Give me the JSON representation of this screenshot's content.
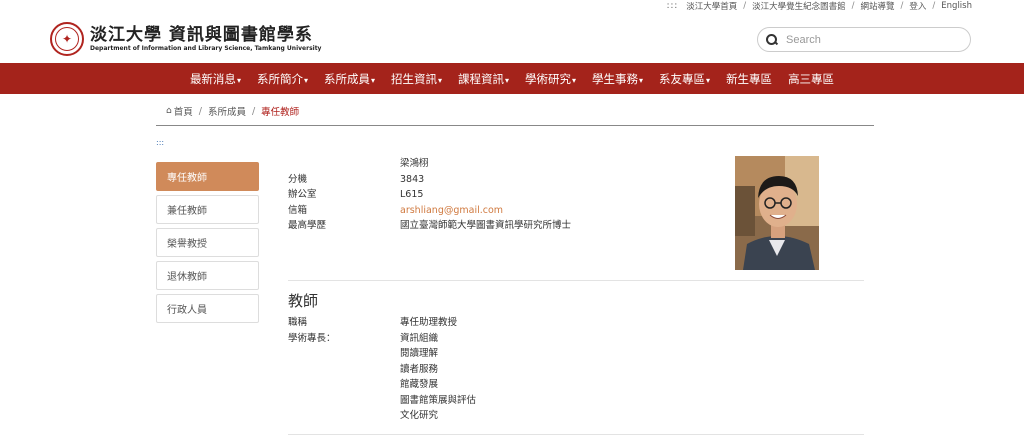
{
  "toplinks": {
    "icon": ":::",
    "items": [
      "淡江大學首頁",
      "淡江大學覺生紀念圖書館",
      "網站導覽",
      "登入",
      "English"
    ]
  },
  "logo": {
    "zh": "淡江大學 資訊與圖書館學系",
    "en": "Department of Information and Library Science, Tamkang University"
  },
  "search": {
    "placeholder": "Search"
  },
  "nav": [
    {
      "label": "最新消息",
      "caret": "▾"
    },
    {
      "label": "系所簡介",
      "caret": "▾"
    },
    {
      "label": "系所成員",
      "caret": "▾"
    },
    {
      "label": "招生資訊",
      "caret": "▾"
    },
    {
      "label": "課程資訊",
      "caret": "▾"
    },
    {
      "label": "學術研究",
      "caret": "▾"
    },
    {
      "label": "學生事務",
      "caret": "▾"
    },
    {
      "label": "系友專區",
      "caret": "▾"
    },
    {
      "label": "新生專區",
      "caret": ""
    },
    {
      "label": "高三專區",
      "caret": ""
    }
  ],
  "breadcrumb": [
    "首頁",
    "系所成員",
    "專任教師"
  ],
  "dots": ":::",
  "sidebar": [
    "專任教師",
    "兼任教師",
    "榮譽教授",
    "退休教師",
    "行政人員"
  ],
  "profile": {
    "name": "梁鴻栩",
    "rows": [
      {
        "label": "分機",
        "value": "3843"
      },
      {
        "label": "辦公室",
        "value": "L615"
      },
      {
        "label": "信箱",
        "value": "arshliang@gmail.com"
      },
      {
        "label": "最高學歷",
        "value": "國立臺灣師範大學圖書資訊學研究所博士"
      }
    ]
  },
  "teacher": {
    "title": "教師",
    "position_label": "職稱",
    "position_value": "專任助理教授",
    "specialty_label": "學術專長：",
    "specialties": [
      "資訊組織",
      "閱讀理解",
      "讀者服務",
      "館藏發展",
      "圖書館策展與評估",
      "文化研究"
    ]
  },
  "colors": {
    "nav_bg": "#a4231b",
    "accent": "#b0241f",
    "active_side": "#d08a5a",
    "link": "#d07a40"
  }
}
